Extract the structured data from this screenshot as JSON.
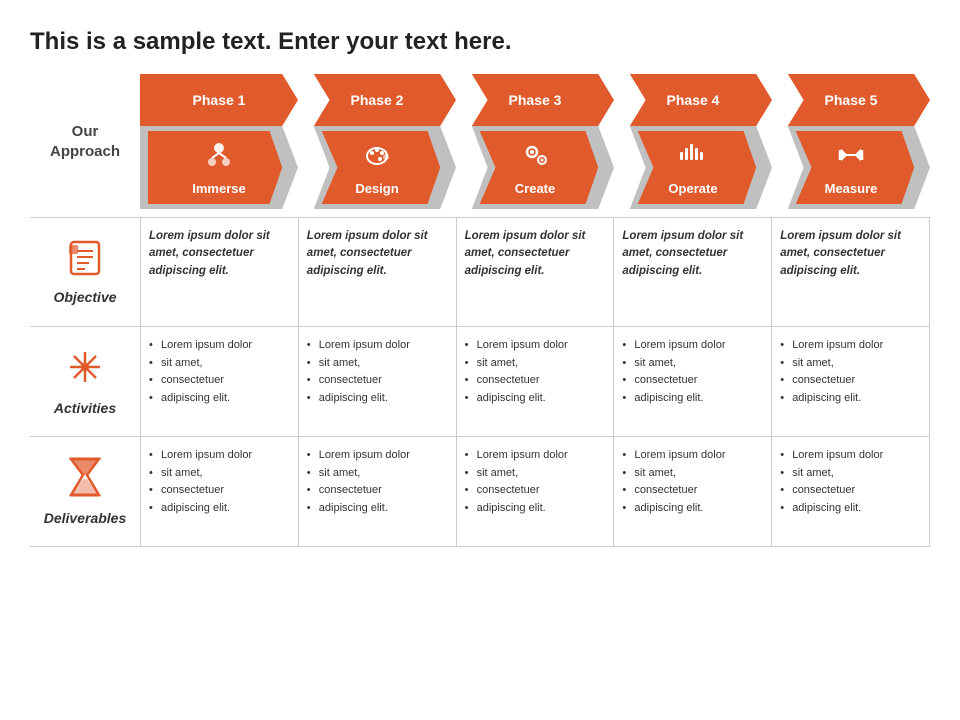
{
  "title": "This is a sample text. Enter your text here.",
  "approach_label": "Our\nApproach",
  "phases": [
    {
      "id": 1,
      "label": "Phase 1",
      "icon": "☺",
      "icon_symbol": "immerse",
      "name": "Immerse",
      "color_top": "#e05a2b",
      "color_bottom": "#e05a2b"
    },
    {
      "id": 2,
      "label": "Phase 2",
      "icon": "🎨",
      "icon_symbol": "design",
      "name": "Design",
      "color_top": "#e05a2b",
      "color_bottom": "#e05a2b"
    },
    {
      "id": 3,
      "label": "Phase 3",
      "icon": "⚙",
      "icon_symbol": "create",
      "name": "Create",
      "color_top": "#e05a2b",
      "color_bottom": "#e05a2b"
    },
    {
      "id": 4,
      "label": "Phase 4",
      "icon": "📊",
      "icon_symbol": "operate",
      "name": "Operate",
      "color_top": "#e05a2b",
      "color_bottom": "#e05a2b"
    },
    {
      "id": 5,
      "label": "Phase 5",
      "icon": "↔",
      "icon_symbol": "measure",
      "name": "Measure",
      "color_top": "#e05a2b",
      "color_bottom": "#e05a2b"
    }
  ],
  "rows": [
    {
      "id": "objective",
      "label": "Objective",
      "icon": "📋",
      "icon_type": "checklist",
      "type": "italic",
      "cells": [
        "Lorem ipsum dolor sit amet, consectetuer adipiscing elit.",
        "Lorem ipsum dolor sit amet, consectetuer adipiscing elit.",
        "Lorem ipsum dolor sit amet, consectetuer adipiscing elit.",
        "Lorem ipsum dolor sit amet, consectetuer adipiscing elit.",
        "Lorem ipsum dolor sit amet, consectetuer adipiscing elit."
      ]
    },
    {
      "id": "activities",
      "label": "Activities",
      "icon": "✦",
      "icon_type": "star",
      "type": "bullets",
      "cells": [
        [
          "Lorem ipsum dolor",
          "sit amet,",
          "consectetuer",
          "adipiscing elit."
        ],
        [
          "Lorem ipsum dolor",
          "sit amet,",
          "consectetuer",
          "adipiscing elit."
        ],
        [
          "Lorem ipsum dolor",
          "sit amet,",
          "consectetuer",
          "adipiscing elit."
        ],
        [
          "Lorem ipsum dolor",
          "sit amet,",
          "consectetuer",
          "adipiscing elit."
        ],
        [
          "Lorem ipsum dolor",
          "sit amet,",
          "consectetuer",
          "adipiscing elit."
        ]
      ]
    },
    {
      "id": "deliverables",
      "label": "Deliverables",
      "icon": "⌛",
      "icon_type": "hourglass",
      "type": "bullets",
      "cells": [
        [
          "Lorem ipsum dolor",
          "sit amet,",
          "consectetuer",
          "adipiscing elit."
        ],
        [
          "Lorem ipsum dolor",
          "sit amet,",
          "consectetuer",
          "adipiscing elit."
        ],
        [
          "Lorem ipsum dolor",
          "sit amet,",
          "consectetuer",
          "adipiscing elit."
        ],
        [
          "Lorem ipsum dolor",
          "sit amet,",
          "consectetuer",
          "adipiscing elit."
        ],
        [
          "Lorem ipsum dolor",
          "sit amet,",
          "consectetuer",
          "adipiscing elit."
        ]
      ]
    }
  ]
}
